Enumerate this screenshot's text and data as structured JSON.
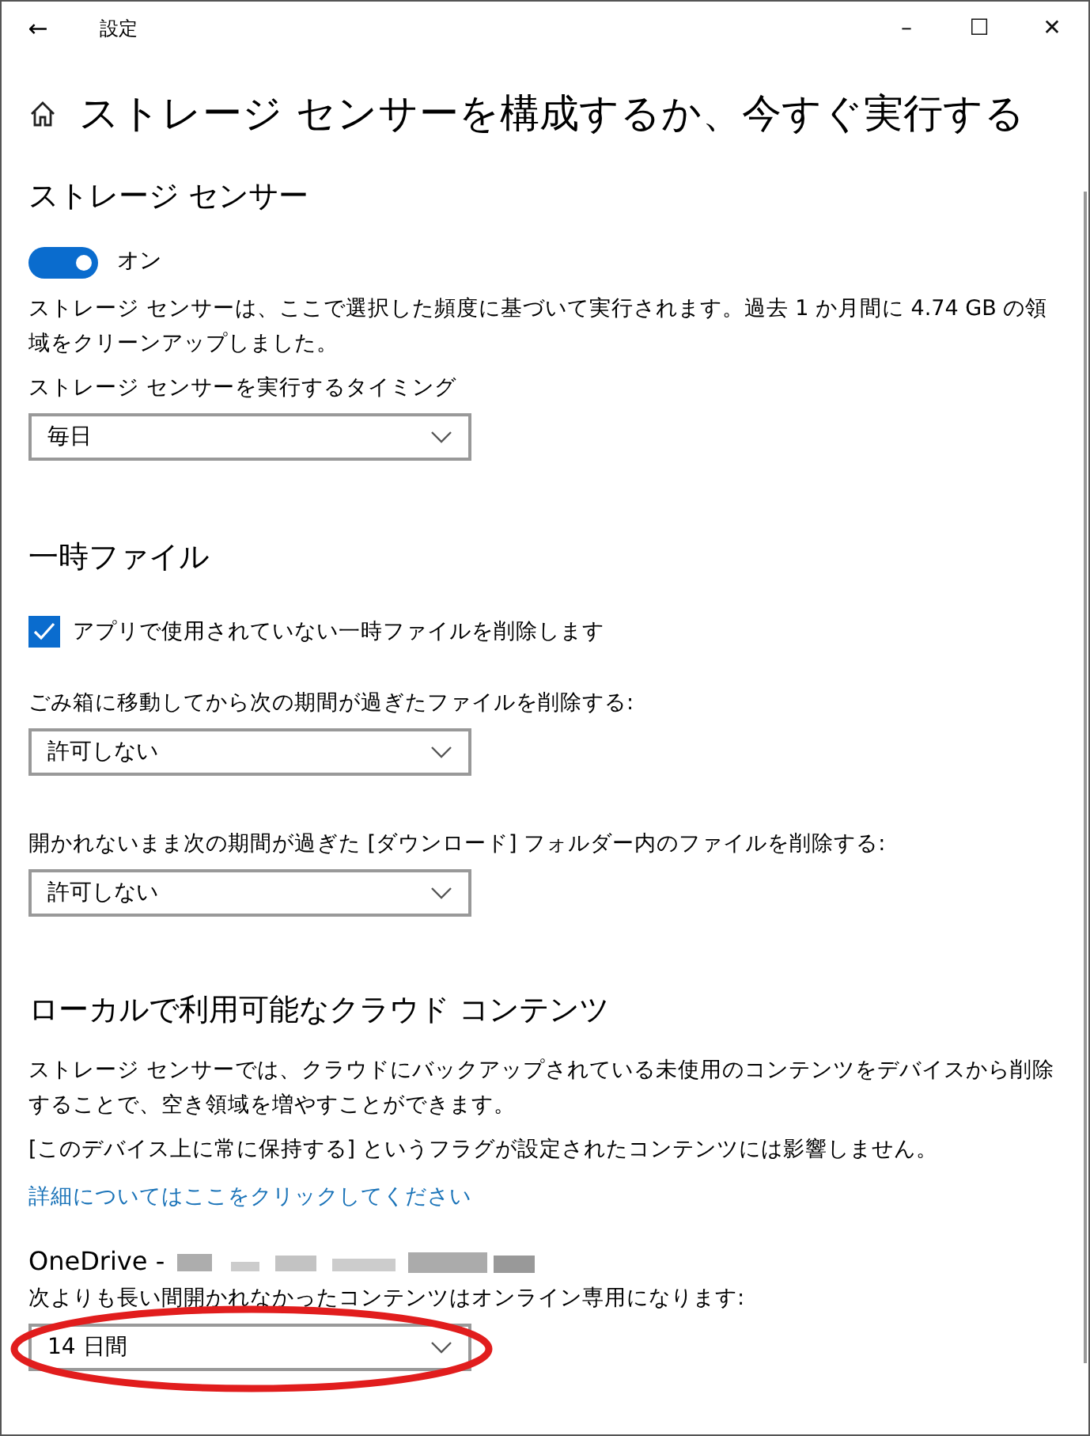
{
  "window": {
    "title": "設定",
    "back_glyph": "←",
    "controls": [
      "–",
      "☐",
      "✕"
    ]
  },
  "page_title": "ストレージ センサーを構成するか、今すぐ実行する",
  "sections": [
    {
      "kind": "sensor",
      "heading": "ストレージ センサー",
      "toggle": {
        "on": true,
        "label": "オン"
      },
      "description": "ストレージ センサーは、ここで選択した頻度に基づいて実行されます。過去 1 か月間に 4.74 GB の領域をクリーンアップしました。",
      "dropdowns": [
        {
          "label": "ストレージ センサーを実行するタイミング",
          "value": "毎日",
          "highlighted": false
        }
      ]
    },
    {
      "kind": "temp",
      "heading": "一時ファイル",
      "checkbox": {
        "checked": true,
        "label": "アプリで使用されていない一時ファイルを削除します"
      },
      "dropdowns": [
        {
          "label": "ごみ箱に移動してから次の期間が過ぎたファイルを削除する:",
          "value": "許可しない",
          "highlighted": false
        },
        {
          "label": "開かれないまま次の期間が過ぎた [ダウンロード] フォルダー内のファイルを削除する:",
          "value": "許可しない",
          "highlighted": false
        }
      ]
    },
    {
      "kind": "cloud",
      "heading": "ローカルで利用可能なクラウド コンテンツ",
      "paragraphs": [
        "ストレージ センサーでは、クラウドにバックアップされている未使用のコンテンツをデバイスから削除することで、空き領域を増やすことができます。",
        "[このデバイス上に常に保持する] というフラグが設定されたコンテンツには影響しません。"
      ],
      "link": "詳細についてはここをクリックしてください",
      "account": "OneDrive -",
      "dropdowns": [
        {
          "label": "次よりも長い間開かれなかったコンテンツはオンライン専用になります:",
          "value": "14 日間",
          "highlighted": true
        }
      ]
    }
  ]
}
